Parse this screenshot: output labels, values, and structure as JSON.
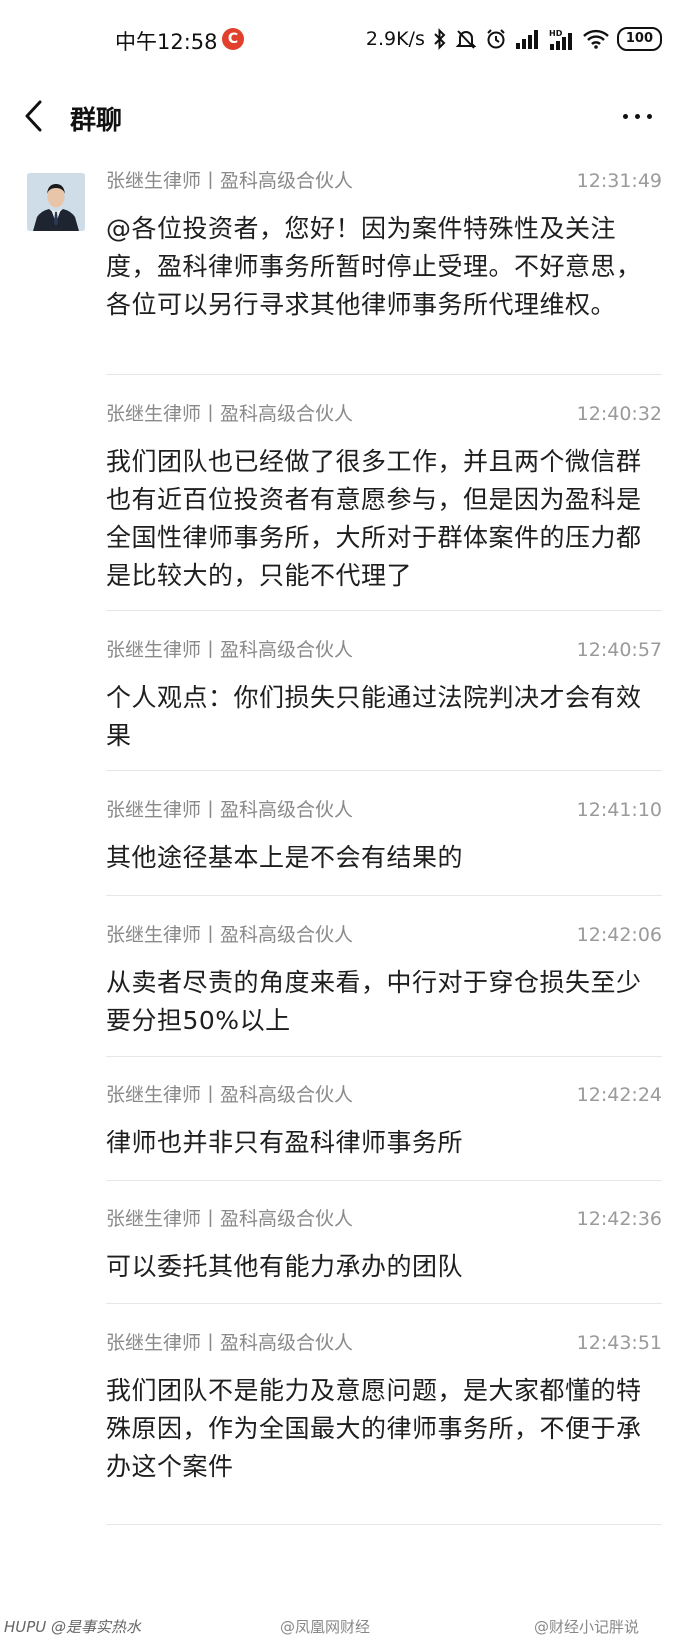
{
  "status_bar": {
    "time": "中午12:58",
    "app_badge": "C",
    "net_speed": "2.9K/s",
    "battery": "100",
    "icons": [
      "bluetooth-icon",
      "mute-icon",
      "alarm-icon",
      "signal-icon",
      "hd-signal-icon",
      "wifi-icon",
      "battery-icon"
    ]
  },
  "header": {
    "title": "群聊",
    "back_icon": "chevron-left-icon",
    "more_icon": "more-dots-icon"
  },
  "messages": [
    {
      "sender": "张继生律师丨盈科高级合伙人",
      "time": "12:31:49",
      "text": "@各位投资者，您好！因为案件特殊性及关注度，盈科律师事务所暂时停止受理。不好意思，各位可以另行寻求其他律师事务所代理维权。"
    },
    {
      "sender": "张继生律师丨盈科高级合伙人",
      "time": "12:40:32",
      "text": "我们团队也已经做了很多工作，并且两个微信群也有近百位投资者有意愿参与，但是因为盈科是全国性律师事务所，大所对于群体案件的压力都是比较大的，只能不代理了"
    },
    {
      "sender": "张继生律师丨盈科高级合伙人",
      "time": "12:40:57",
      "text": "个人观点：你们损失只能通过法院判决才会有效果"
    },
    {
      "sender": "张继生律师丨盈科高级合伙人",
      "time": "12:41:10",
      "text": "其他途径基本上是不会有结果的"
    },
    {
      "sender": "张继生律师丨盈科高级合伙人",
      "time": "12:42:06",
      "text": "从卖者尽责的角度来看，中行对于穿仓损失至少要分担50%以上"
    },
    {
      "sender": "张继生律师丨盈科高级合伙人",
      "time": "12:42:24",
      "text": "律师也并非只有盈科律师事务所"
    },
    {
      "sender": "张继生律师丨盈科高级合伙人",
      "time": "12:42:36",
      "text": "可以委托其他有能力承办的团队"
    },
    {
      "sender": "张继生律师丨盈科高级合伙人",
      "time": "12:43:51",
      "text": "我们团队不是能力及意愿问题，是大家都懂的特殊原因，作为全国最大的律师事务所，不便于承办这个案件"
    }
  ],
  "watermarks": {
    "left": "HUPU @是事实热水",
    "middle": "@凤凰网财经",
    "right": "@财经小记胖说"
  }
}
